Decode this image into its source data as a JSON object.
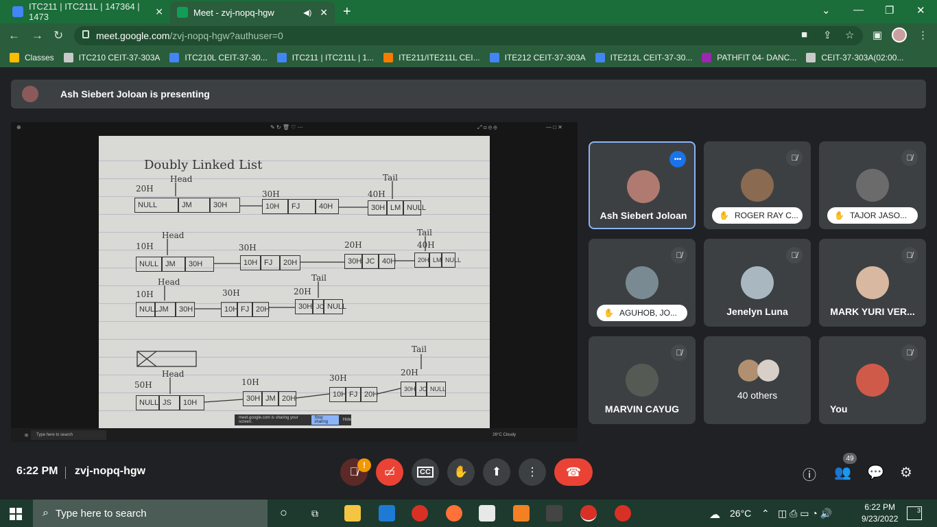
{
  "browser": {
    "tabs": [
      {
        "label": "ITC211 | ITC211L | 147364 | 1473",
        "favicon_color": "#4285f4"
      },
      {
        "label": "Meet - zvj-nopq-hgw",
        "favicon_color": "#0f9d58"
      }
    ],
    "url_host": "meet.google.com",
    "url_path": "/zvj-nopq-hgw?authuser=0",
    "bookmarks": [
      {
        "label": "Classes",
        "color": "#fbbc04"
      },
      {
        "label": "ITC210 CEIT-37-303A",
        "color": "#c9c9c9"
      },
      {
        "label": "ITC210L CEIT-37-30...",
        "color": "#4285f4"
      },
      {
        "label": "ITC211 | ITC211L | 1...",
        "color": "#4285f4"
      },
      {
        "label": "ITE211/ITE211L CEI...",
        "color": "#f57c00"
      },
      {
        "label": "ITE212 CEIT-37-303A",
        "color": "#4285f4"
      },
      {
        "label": "ITE212L CEIT-37-30...",
        "color": "#4285f4"
      },
      {
        "label": "PATHFIT 04- DANC...",
        "color": "#9c27b0"
      },
      {
        "label": "CEIT-37-303A(02:00...",
        "color": "#c9c9c9"
      }
    ]
  },
  "meet": {
    "presenting_banner": "Ash Siebert Joloan is presenting",
    "time": "6:22 PM",
    "meeting_code": "zvj-nopq-hgw",
    "participant_count": "49",
    "alert_badge": "!",
    "participants": [
      {
        "name": "Ash Siebert Joloan",
        "style": "name",
        "active": true,
        "color": "#b07a70"
      },
      {
        "name": "ROGER RAY C...",
        "style": "pill",
        "active": false,
        "color": "#8a6a50"
      },
      {
        "name": "TAJOR JASO...",
        "style": "pill",
        "active": false,
        "color": "#6b6b6b"
      },
      {
        "name": "AGUHOB, JO...",
        "style": "pill",
        "active": false,
        "color": "#7a8a92"
      },
      {
        "name": "Jenelyn Luna",
        "style": "name",
        "active": false,
        "color": "#a9b8c0"
      },
      {
        "name": "MARK YURI VER...",
        "style": "name",
        "active": false,
        "color": "#d8b8a0"
      },
      {
        "name": "MARVIN CAYUG",
        "style": "name",
        "active": false,
        "color": "#555a55"
      },
      {
        "name": "40 others",
        "style": "others",
        "active": false,
        "color": "#b09070"
      },
      {
        "name": "You",
        "style": "name",
        "active": false,
        "color": "#d05a4a"
      }
    ]
  },
  "shared_screen": {
    "heading": "Doubly   Linked   List",
    "share_notice": "meet.google.com is sharing your screen.",
    "stop_sharing": "Stop sharing",
    "hide": "Hide",
    "inner_search": "Type here to search",
    "inner_weather": "26°C  Cloudy",
    "row1": [
      "NULL",
      "JM",
      "30H",
      "10H",
      "FJ",
      "40H",
      "30H",
      "LM",
      "NULL"
    ],
    "labels1": [
      "20H",
      "Head",
      "30H",
      "40H",
      "Tail"
    ],
    "row2": [
      "NULL",
      "JM",
      "30H",
      "10H",
      "FJ",
      "20H",
      "30H",
      "JC",
      "40H",
      "20H",
      "LM",
      "NULL"
    ],
    "labels2": [
      "10H",
      "Head",
      "30H",
      "20H",
      "Tail",
      "40H"
    ],
    "row3": [
      "NULL",
      "JM",
      "30H",
      "10H",
      "FJ",
      "20H",
      "30H",
      "JC",
      "NULL"
    ],
    "labels3": [
      "10H",
      "Head",
      "30H",
      "20H",
      "Tail"
    ],
    "row4": [
      "NULL",
      "JS",
      "10H",
      "30H",
      "JM",
      "20H",
      "10H",
      "FJ",
      "20H",
      "30H",
      "JC",
      "NULL"
    ],
    "labels4": [
      "50H",
      "Head",
      "10H",
      "30H",
      "20H",
      "Tail"
    ]
  },
  "taskbar": {
    "search_placeholder": "Type here to search",
    "weather": "26°C",
    "time": "6:22 PM",
    "date": "9/23/2022",
    "notification_count": "3"
  }
}
